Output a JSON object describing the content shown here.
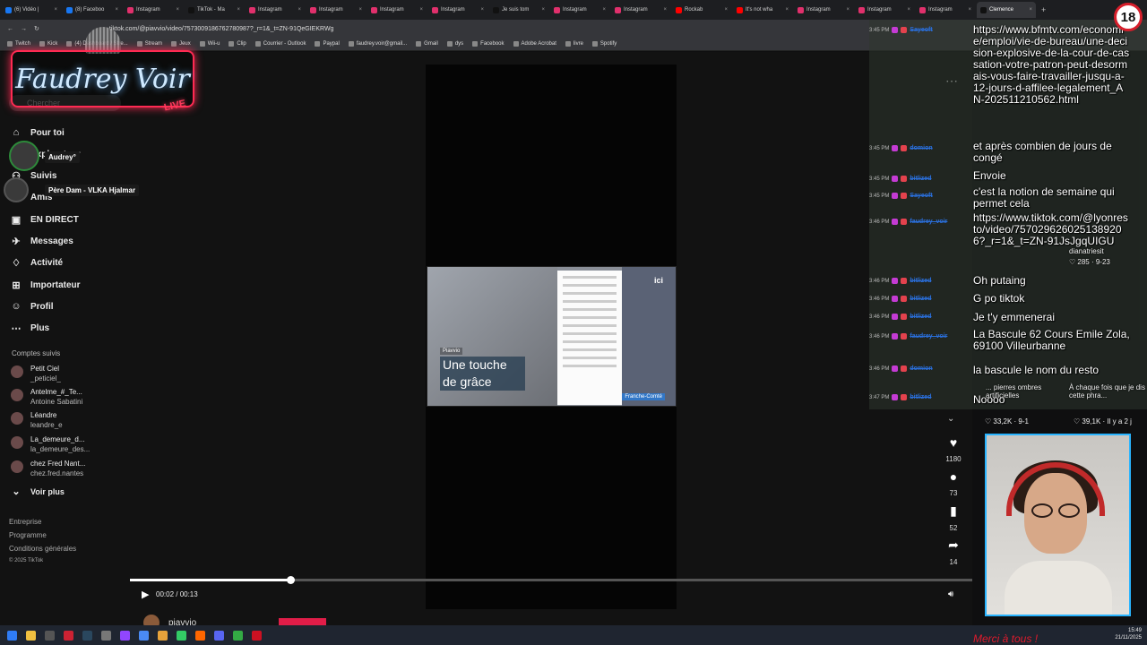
{
  "browser": {
    "tabs": [
      {
        "label": "(6) Vidéo |",
        "color": "#1877f2"
      },
      {
        "label": "(8) Faceboo",
        "color": "#1877f2"
      },
      {
        "label": "Instagram",
        "color": "#e1306c"
      },
      {
        "label": "TikTok - Ma",
        "color": "#111111"
      },
      {
        "label": "Instagram",
        "color": "#e1306c"
      },
      {
        "label": "Instagram",
        "color": "#e1306c"
      },
      {
        "label": "Instagram",
        "color": "#e1306c"
      },
      {
        "label": "Instagram",
        "color": "#e1306c"
      },
      {
        "label": "Je suis tom",
        "color": "#111111"
      },
      {
        "label": "Instagram",
        "color": "#e1306c"
      },
      {
        "label": "Instagram",
        "color": "#e1306c"
      },
      {
        "label": "Rockab",
        "color": "#ff0000"
      },
      {
        "label": "It's not wha",
        "color": "#ff0000"
      },
      {
        "label": "Instagram",
        "color": "#e1306c"
      },
      {
        "label": "Instagram",
        "color": "#e1306c"
      },
      {
        "label": "Instagram",
        "color": "#e1306c"
      },
      {
        "label": "Clemence",
        "color": "#111111",
        "active": true
      }
    ],
    "new_tab": "+",
    "url": "tiktok.com/@piavvio/video/7573009186762780987?_r=1&_t=ZN-91QeGIEKRWg",
    "bookmarks": [
      "Twitch",
      "Kick",
      "(4) Dashboard / Stre...",
      "Stream",
      "Jeux",
      "Wii-u",
      "Clip",
      "Courrier - Outlook",
      "Paypal",
      "faudrey.voir@gmail...",
      "Gmail",
      "dys",
      "Facebook",
      "Adobe Acrobat",
      "livre",
      "Spotify"
    ]
  },
  "sidebar": {
    "search_placeholder": "Chercher",
    "nav": [
      {
        "label": "Pour toi",
        "icon": "home-icon",
        "glyph": "⌂"
      },
      {
        "label": "Explorateur",
        "icon": "compass-icon",
        "glyph": "◎"
      },
      {
        "label": "Suivis",
        "icon": "following-icon",
        "glyph": "⚇"
      },
      {
        "label": "Amis",
        "icon": "friends-icon",
        "glyph": "⚉"
      },
      {
        "label": "EN DIRECT",
        "icon": "live-icon",
        "glyph": "▣"
      },
      {
        "label": "Messages",
        "icon": "messages-icon",
        "glyph": "✈"
      },
      {
        "label": "Activité",
        "icon": "activity-icon",
        "glyph": "♢"
      },
      {
        "label": "Importateur",
        "icon": "upload-icon",
        "glyph": "⊞"
      },
      {
        "label": "Profil",
        "icon": "profile-icon",
        "glyph": "☺"
      },
      {
        "label": "Plus",
        "icon": "more-icon",
        "glyph": "⋯"
      }
    ],
    "following_title": "Comptes suivis",
    "following": [
      {
        "name": "Petit Ciel",
        "handle": "_peticiel_"
      },
      {
        "name": "Antelme_#_Te...",
        "handle": "Antoine Sabatini"
      },
      {
        "name": "Léandre",
        "handle": "leandre_e"
      },
      {
        "name": "La_demeure_d...",
        "handle": "la_demeure_des..."
      },
      {
        "name": "chez Fred Nant...",
        "handle": "chez.fred.nantes"
      }
    ],
    "see_more": "Voir plus",
    "footer": [
      "Entreprise",
      "Programme",
      "Conditions générales",
      "© 2025 TikTok"
    ]
  },
  "overlay": {
    "logo_text": "Faudrey Voir",
    "logo_live": "LIVE",
    "tooltip_1": "Audrey°",
    "tooltip_2": "Père Dam - VLKA Hjalmar",
    "age_badge": "18",
    "bottom_text": "Merci à tous !"
  },
  "video": {
    "tag": "Piavvio",
    "title": "Une touche de grâce",
    "logo": "ici",
    "badge": "Franche-Comté",
    "time": "00:02 / 00:13",
    "progress": 0.19,
    "author": "piavvio"
  },
  "actions": [
    {
      "icon": "heart-icon",
      "glyph": "♥",
      "count": "1180"
    },
    {
      "icon": "comment-icon",
      "glyph": "●",
      "count": "73"
    },
    {
      "icon": "bookmark-icon",
      "glyph": "▮",
      "count": "52"
    },
    {
      "icon": "share-icon",
      "glyph": "➦",
      "count": "14"
    }
  ],
  "chat": [
    {
      "time": "3:45 PM",
      "user": "Sayeoft",
      "msg": "https://www.bfmtv.com/economie/emploi/vie-de-bureau/une-decision-explosive-de-la-cour-de-cassation-votre-patron-peut-desormais-vous-faire-travailler-jusqu-a-12-jours-d-affilee-legalement_AN-202511210562.html"
    },
    {
      "time": "3:45 PM",
      "user": "domion",
      "msg": "et après combien de jours de congé"
    },
    {
      "time": "3:45 PM",
      "user": "bitlized",
      "msg": "Envoie"
    },
    {
      "time": "3:45 PM",
      "user": "Sayeoft",
      "msg": "c'est la notion de semaine qui permet cela"
    },
    {
      "time": "3:46 PM",
      "user": "faudrey_voir",
      "msg": "https://www.tiktok.com/@lyonresto/video/7570296260251389206?_r=1&_t=ZN-91JsJgqUIGU"
    },
    {
      "time": "3:46 PM",
      "user": "bitlized",
      "msg": "Oh putaing"
    },
    {
      "time": "3:46 PM",
      "user": "bitlized",
      "msg": "G po tiktok"
    },
    {
      "time": "3:46 PM",
      "user": "bitlized",
      "msg": "Je t'y emmenerai"
    },
    {
      "time": "3:46 PM",
      "user": "faudrey_voir",
      "msg": "La Bascule 62 Cours Emile Zola, 69100 Villeurbanne"
    },
    {
      "time": "3:46 PM",
      "user": "domion",
      "msg": "la bascule le nom du resto"
    },
    {
      "time": "3:47 PM",
      "user": "bitlized",
      "msg": "Noooo"
    }
  ],
  "ghost_texts": {
    "g1": "dianatriesit",
    "g2": "♡ 285 · 9-23",
    "g3": "... pierres ombres artificielles",
    "g4": "À chaque fois que je dis cette phra...",
    "g5": "♡ 33,2K · 9-1",
    "g6": "♡ 39,1K · Il y a 2 j"
  },
  "clock": {
    "time": "15:49",
    "date": "21/11/2025"
  }
}
